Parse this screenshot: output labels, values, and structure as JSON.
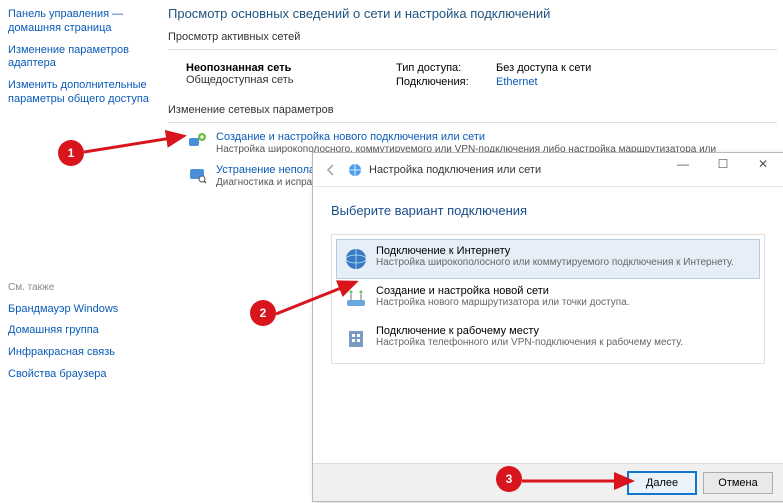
{
  "sidebar": {
    "items": [
      "Панель управления — домашняя страница",
      "Изменение параметров адаптера",
      "Изменить дополнительные параметры общего доступа"
    ],
    "see_also_label": "См. также",
    "see_also_items": [
      "Брандмауэр Windows",
      "Домашняя группа",
      "Инфракрасная связь",
      "Свойства браузера"
    ]
  },
  "main": {
    "title": "Просмотр основных сведений о сети и настройка подключений",
    "active_networks_label": "Просмотр активных сетей",
    "network": {
      "name": "Неопознанная сеть",
      "category": "Общедоступная сеть",
      "access_label": "Тип доступа:",
      "access_value": "Без доступа к сети",
      "connections_label": "Подключения:",
      "connections_value": "Ethernet"
    },
    "change_label": "Изменение сетевых параметров",
    "setting1": {
      "title": "Создание и настройка нового подключения или сети",
      "desc": "Настройка широкополосного, коммутируемого или VPN-подключения либо настройка маршрутизатора или"
    },
    "setting2": {
      "title": "Устранение неполад",
      "desc": "Диагностика и испра\nнеполадок."
    }
  },
  "dialog": {
    "title": "Настройка подключения или сети",
    "heading": "Выберите вариант подключения",
    "options": [
      {
        "title": "Подключение к Интернету",
        "desc": "Настройка широкополосного или коммутируемого подключения к Интернету."
      },
      {
        "title": "Создание и настройка новой сети",
        "desc": "Настройка нового маршрутизатора или точки доступа."
      },
      {
        "title": "Подключение к рабочему месту",
        "desc": "Настройка телефонного или VPN-подключения к рабочему месту."
      }
    ],
    "btn_next": "Далее",
    "btn_cancel": "Отмена"
  },
  "annotations": {
    "b1": "1",
    "b2": "2",
    "b3": "3"
  }
}
